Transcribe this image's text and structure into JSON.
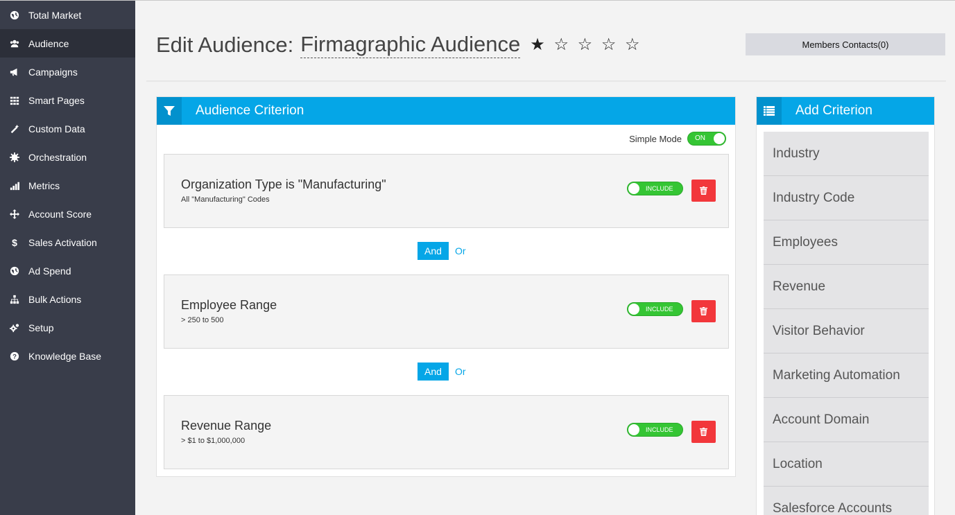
{
  "sidebar": {
    "items": [
      {
        "label": "Total Market",
        "icon": "globe-icon"
      },
      {
        "label": "Audience",
        "icon": "users-icon",
        "active": true
      },
      {
        "label": "Campaigns",
        "icon": "bullhorn-icon"
      },
      {
        "label": "Smart Pages",
        "icon": "grid-icon"
      },
      {
        "label": "Custom Data",
        "icon": "wand-icon"
      },
      {
        "label": "Orchestration",
        "icon": "cog-icon"
      },
      {
        "label": "Metrics",
        "icon": "bar-chart-icon"
      },
      {
        "label": "Account Score",
        "icon": "crosshair-icon"
      },
      {
        "label": "Sales Activation",
        "icon": "dollar-icon"
      },
      {
        "label": "Ad Spend",
        "icon": "globe-icon"
      },
      {
        "label": "Bulk Actions",
        "icon": "sitemap-icon"
      },
      {
        "label": "Setup",
        "icon": "cogs-icon"
      },
      {
        "label": "Knowledge Base",
        "icon": "question-circle-icon"
      }
    ]
  },
  "header": {
    "title_prefix": "Edit Audience:",
    "audience_name": "Firmagraphic Audience",
    "stars": [
      "★",
      "☆",
      "☆",
      "☆",
      "☆"
    ],
    "members_button": "Members Contacts(0)"
  },
  "criterion_panel": {
    "title": "Audience Criterion",
    "simple_mode_label": "Simple Mode",
    "simple_mode_toggle": "ON",
    "cards": [
      {
        "title": "Organization Type is \"Manufacturing\"",
        "subtitle": "All \"Manufacturing\" Codes",
        "toggle": "INCLUDE"
      },
      {
        "title": "Employee Range",
        "subtitle": "> 250 to 500",
        "toggle": "INCLUDE"
      },
      {
        "title": "Revenue Range",
        "subtitle": "> $1 to $1,000,000",
        "toggle": "INCLUDE"
      }
    ],
    "logic": [
      {
        "and": "And",
        "or": "Or"
      },
      {
        "and": "And",
        "or": "Or"
      }
    ]
  },
  "add_panel": {
    "title": "Add Criterion",
    "items": [
      "Industry",
      "Industry Code",
      "Employees",
      "Revenue",
      "Visitor Behavior",
      "Marketing Automation",
      "Account Domain",
      "Location",
      "Salesforce Accounts"
    ]
  },
  "colors": {
    "accent": "#05a6e7",
    "sidebar": "#393d4a",
    "toggle_green": "#35c534",
    "delete_red": "#f2373b"
  }
}
